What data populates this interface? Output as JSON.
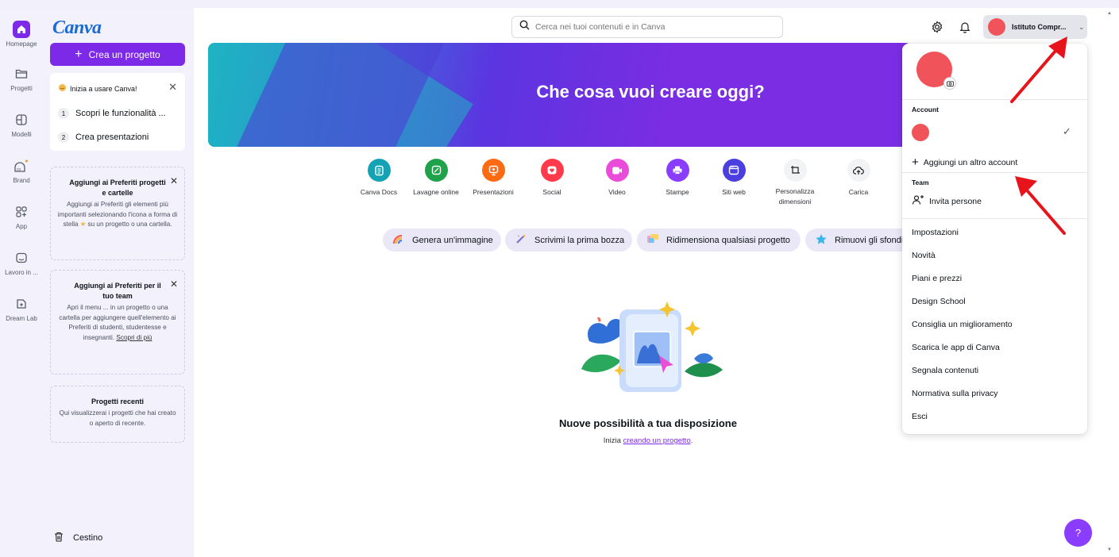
{
  "rail": {
    "items": [
      {
        "label": "Homepage",
        "icon": "home-icon"
      },
      {
        "label": "Progetti",
        "icon": "folder-icon"
      },
      {
        "label": "Modelli",
        "icon": "templates-icon"
      },
      {
        "label": "Brand",
        "icon": "brand-icon"
      },
      {
        "label": "App",
        "icon": "apps-icon"
      },
      {
        "label": "Lavoro in ...",
        "icon": "inbox-icon"
      },
      {
        "label": "Dream Lab",
        "icon": "dream-lab-icon"
      }
    ]
  },
  "panel": {
    "logo": "Canva",
    "create_label": "Crea un progetto",
    "getting_started": {
      "title": "Inizia a usare Canva!",
      "steps": [
        {
          "num": "1",
          "label": "Scopri le funzionalità ..."
        },
        {
          "num": "2",
          "label": "Crea presentazioni"
        }
      ]
    },
    "favorites": {
      "title": "Aggiungi ai Preferiti progetti e cartelle",
      "text_before": "Aggiungi ai Preferiti gli elementi più importanti selezionando l'icona a forma di stella",
      "text_after": "su un progetto o una cartella."
    },
    "team_favorites": {
      "title": "Aggiungi ai Preferiti per il tuo team",
      "text": "Apri il menu ... in un progetto o una cartella per aggiungere quell'elemento ai Preferiti di studenti, studentesse e insegnanti.",
      "link": "Scopri di più"
    },
    "recent": {
      "title": "Progetti recenti",
      "text": "Qui visualizzerai i progetti che hai creato o aperto di recente."
    },
    "trash_label": "Cestino"
  },
  "header": {
    "search_placeholder": "Cerca nei tuoi contenuti e in Canva",
    "account_name": "Istituto Compr..."
  },
  "banner": {
    "title": "Che cosa vuoi creare oggi?"
  },
  "design_types": [
    {
      "label": "Canva Docs",
      "color": "#13a3b5",
      "icon": "docs-icon"
    },
    {
      "label": "Lavagne online",
      "color": "#1fa34a",
      "icon": "whiteboard-icon"
    },
    {
      "label": "Presentazioni",
      "color": "#ff6a13",
      "icon": "presentation-icon"
    },
    {
      "label": "Social",
      "color": "#ff3b4b",
      "icon": "social-icon"
    },
    {
      "label": "Video",
      "color": "#ea4cda",
      "icon": "video-icon"
    },
    {
      "label": "Stampe",
      "color": "#8b3dff",
      "icon": "print-icon"
    },
    {
      "label": "Siti web",
      "color": "#4b3fe0",
      "icon": "website-icon"
    },
    {
      "label": "Personalizza\ndimensioni",
      "color": "#f2f3f5",
      "icon": "custom-size-icon"
    },
    {
      "label": "Carica",
      "color": "#f2f3f5",
      "icon": "upload-icon"
    }
  ],
  "ai_chips": [
    {
      "label": "Genera un'immagine",
      "icon": "rainbow-icon"
    },
    {
      "label": "Scrivimi la prima bozza",
      "icon": "magic-write-icon"
    },
    {
      "label": "Ridimensiona qualsiasi progetto",
      "icon": "resize-icon"
    },
    {
      "label": "Rimuovi gli sfondi",
      "icon": "bg-remover-icon"
    }
  ],
  "empty_state": {
    "title": "Nuove possibilità a tua disposizione",
    "sub_before": "Inizia ",
    "sub_link": "creando un progetto",
    "sub_after": "."
  },
  "help_label": "?",
  "menu": {
    "account_section": "Account",
    "add_account": "Aggiungi un altro account",
    "team_section": "Team",
    "invite": "Invita persone",
    "items": [
      "Impostazioni",
      "Novità",
      "Piani e prezzi",
      "Design School",
      "Consiglia un miglioramento",
      "Scarica le app di Canva",
      "Segnala contenuti",
      "Normativa sulla privacy",
      "Esci"
    ]
  },
  "colors": {
    "accent": "#7d2ae8",
    "avatar": "#f0545a",
    "annotation_arrow": "#e8141c"
  }
}
